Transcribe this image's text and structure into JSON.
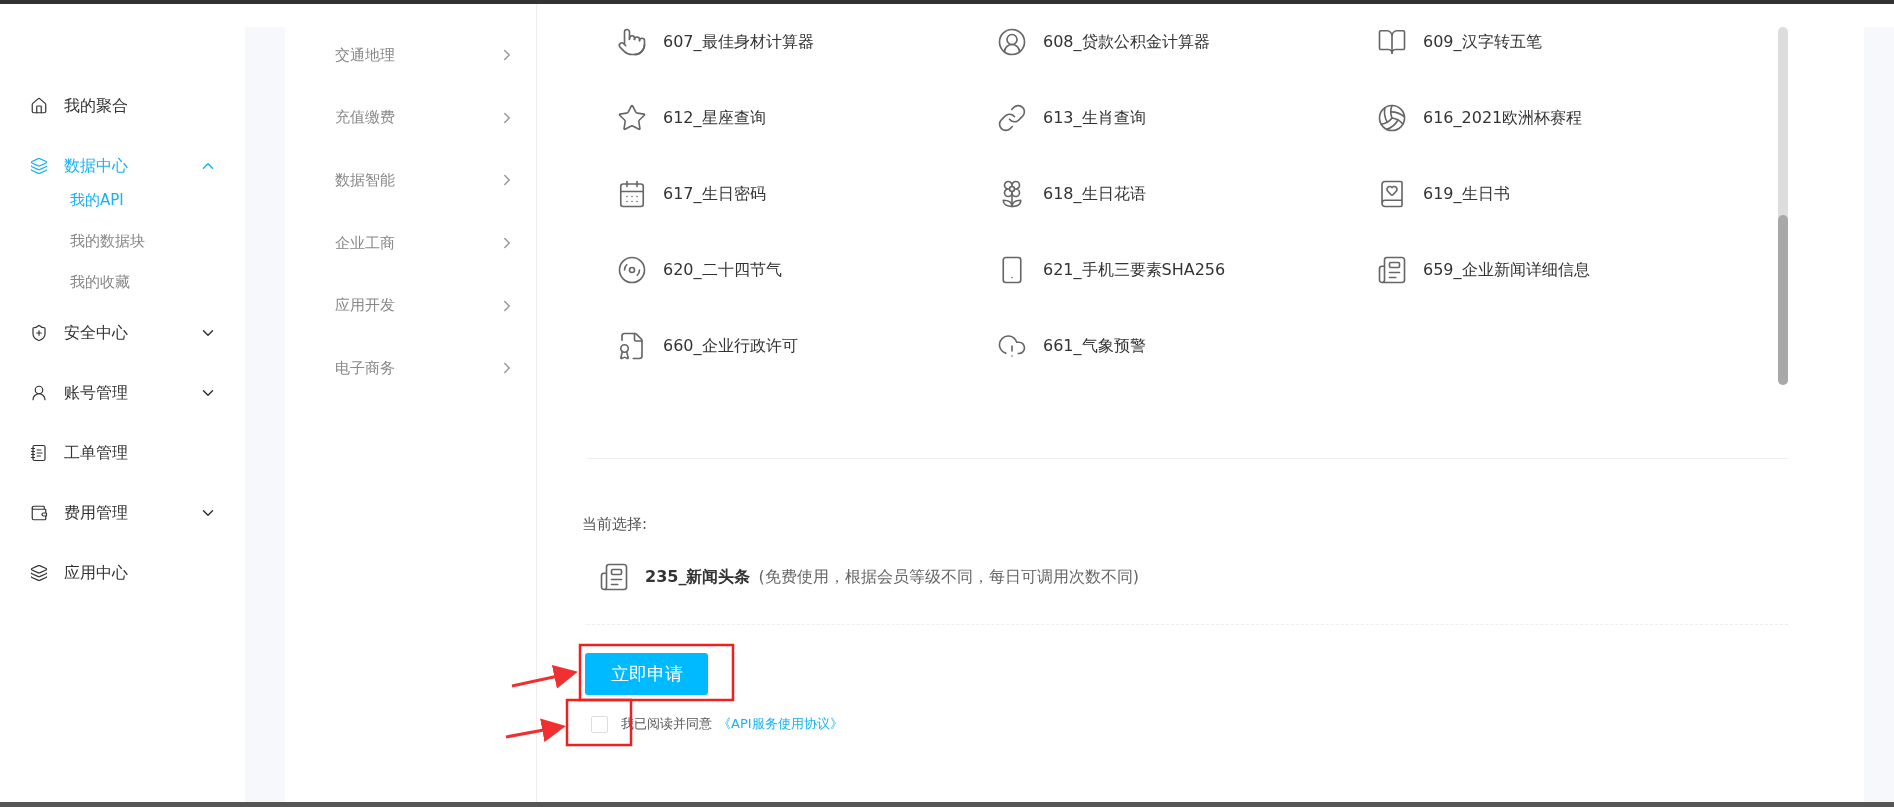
{
  "sidebar": {
    "items": [
      {
        "label": "我的聚合",
        "kind": "link",
        "selected": false
      },
      {
        "label": "数据中心",
        "kind": "group",
        "selected": true,
        "expanded": true,
        "children": [
          {
            "label": "我的API",
            "selected": true
          },
          {
            "label": "我的数据块",
            "selected": false
          },
          {
            "label": "我的收藏",
            "selected": false
          }
        ]
      },
      {
        "label": "安全中心",
        "kind": "group",
        "selected": false,
        "expanded": false
      },
      {
        "label": "账号管理",
        "kind": "group",
        "selected": false,
        "expanded": false
      },
      {
        "label": "工单管理",
        "kind": "link",
        "selected": false
      },
      {
        "label": "费用管理",
        "kind": "group",
        "selected": false,
        "expanded": false
      },
      {
        "label": "应用中心",
        "kind": "link",
        "selected": false
      }
    ]
  },
  "categories": [
    "交通地理",
    "充值缴费",
    "数据智能",
    "企业工商",
    "应用开发",
    "电子商务"
  ],
  "apis": [
    "607_最佳身材计算器",
    "608_贷款公积金计算器",
    "609_汉字转五笔",
    "612_星座查询",
    "613_生肖查询",
    "616_2021欧洲杯赛程",
    "617_生日密码",
    "618_生日花语",
    "619_生日书",
    "620_二十四节气",
    "621_手机三要素SHA256",
    "659_企业新闻详细信息",
    "660_企业行政许可",
    "661_气象预警"
  ],
  "current": {
    "label": "当前选择:",
    "name": "235_新闻头条",
    "note": "(免费使用，根据会员等级不同，每日可调用次数不同)"
  },
  "apply_button": "立即申请",
  "agreement": {
    "checked": false,
    "text": "我已阅读并同意",
    "link": "《API服务使用协议》"
  }
}
